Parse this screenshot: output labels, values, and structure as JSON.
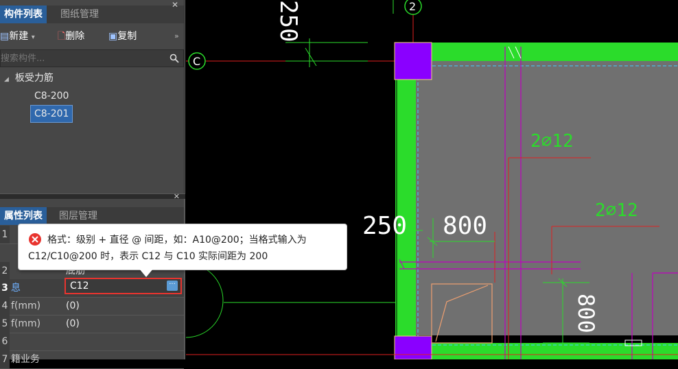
{
  "component_panel": {
    "tabs": [
      "构件列表",
      "图纸管理"
    ],
    "toolbar": {
      "new_label": "新建",
      "delete_label": "删除",
      "copy_label": "复制"
    },
    "search": {
      "placeholder": "搜索构件..."
    },
    "tree": {
      "root": "板受力筋",
      "items": [
        "C8-200",
        "C8-201"
      ],
      "selected": "C8-201"
    }
  },
  "property_panel": {
    "tabs": [
      "属性列表",
      "图层管理"
    ],
    "rows": [
      {
        "num": "1",
        "name": "",
        "value": ""
      },
      {
        "num": "2",
        "name": "",
        "value": "底筋"
      },
      {
        "num": "3",
        "name": "息",
        "value": "C12"
      },
      {
        "num": "4",
        "name": "f(mm)",
        "value": "(0)"
      },
      {
        "num": "5",
        "name": "f(mm)",
        "value": "(0)"
      },
      {
        "num": "6",
        "name": "",
        "value": ""
      },
      {
        "num": "7",
        "name": "籍业务",
        "value": ""
      }
    ],
    "active_field": {
      "value": "C12"
    }
  },
  "tooltip": {
    "line1": "格式：级别 + 直径 @ 间距，如：A10@200；当格式输入为",
    "line2": "C12/C10@200 时，表示 C12 与 C10 实际间距为 200"
  },
  "drawing": {
    "axis_c": "C",
    "axis_2": "2",
    "dim_250_vertical": "250",
    "dim_250": "250",
    "dim_800": "800",
    "dim_800_vertical": "800",
    "rebar_label_1": "2⌀12",
    "rebar_label_2": "2⌀12"
  },
  "colors": {
    "panel_bg": "#474747",
    "tab_active": "#2a5f9a",
    "selection": "#2f68ad",
    "error_red": "#e8342f",
    "wall_green": "#2bdc2b",
    "column_purple": "#8a00ff",
    "magenta": "#c000c0"
  },
  "icons": [
    "new-icon",
    "delete-icon",
    "copy-icon",
    "search-icon",
    "error-icon",
    "more-icon",
    "expand-icon"
  ]
}
